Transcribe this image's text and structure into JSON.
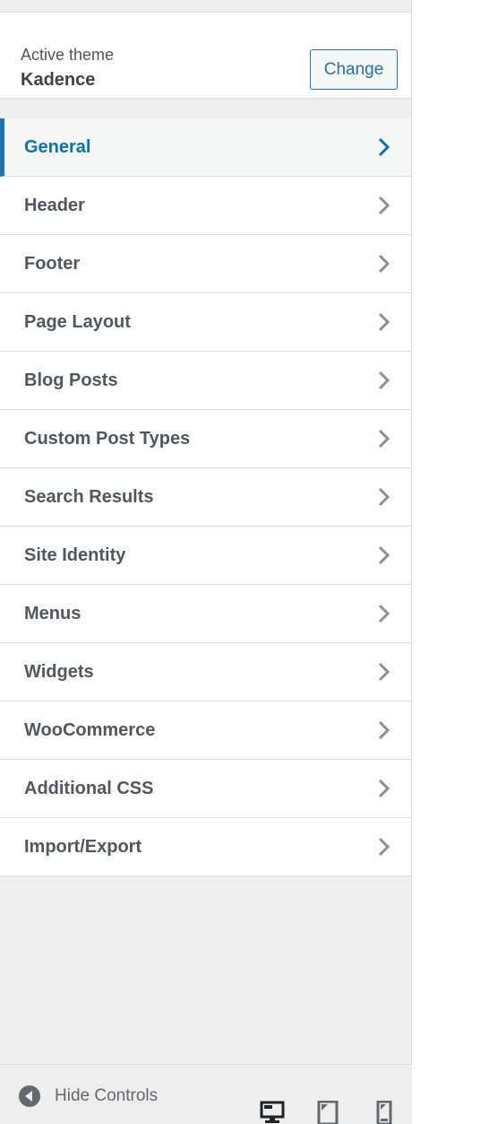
{
  "theme": {
    "label": "Active theme",
    "name": "Kadence",
    "change_label": "Change"
  },
  "menu": {
    "items": [
      {
        "label": "General",
        "active": true
      },
      {
        "label": "Header"
      },
      {
        "label": "Footer"
      },
      {
        "label": "Page Layout"
      },
      {
        "label": "Blog Posts"
      },
      {
        "label": "Custom Post Types"
      },
      {
        "label": "Search Results"
      },
      {
        "label": "Site Identity"
      },
      {
        "label": "Menus"
      },
      {
        "label": "Widgets"
      },
      {
        "label": "WooCommerce"
      },
      {
        "label": "Additional CSS"
      },
      {
        "label": "Import/Export"
      }
    ]
  },
  "footer": {
    "hide_controls_label": "Hide Controls",
    "devices": [
      "desktop-icon",
      "tablet-icon",
      "mobile-icon"
    ],
    "active_device": "desktop-icon"
  },
  "colors": {
    "accent": "#2271b1",
    "active_text": "#0a73aa",
    "item_text": "#50575e",
    "chevron": "#8c8f94"
  }
}
